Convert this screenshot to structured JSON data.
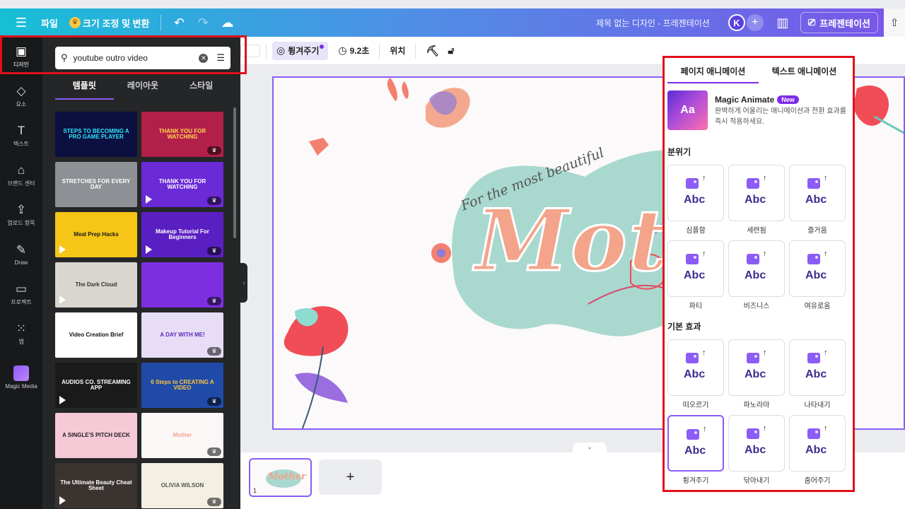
{
  "topbar": {
    "menu_icon": "hamburger-icon",
    "file_label": "파일",
    "resize_label": "크기 조정 및 변환",
    "title": "제목 없는 디자인 - 프레젠테이션",
    "avatar_initial": "K",
    "present_label": "프레젠테이션",
    "gradient_start": "#16bfd6",
    "gradient_end": "#7a55e8"
  },
  "rail": {
    "items": [
      {
        "label": "디자인",
        "icon": "layout-icon"
      },
      {
        "label": "요소",
        "icon": "shapes-icon"
      },
      {
        "label": "텍스트",
        "icon": "text-icon"
      },
      {
        "label": "브랜드 센터",
        "icon": "brand-icon"
      },
      {
        "label": "업로드 항목",
        "icon": "upload-icon"
      },
      {
        "label": "Draw",
        "icon": "draw-icon"
      },
      {
        "label": "프로젝트",
        "icon": "folder-icon"
      },
      {
        "label": "앱",
        "icon": "apps-icon"
      },
      {
        "label": "Magic Media",
        "icon": "magic-media-icon"
      }
    ]
  },
  "panel": {
    "search_value": "youtube outro video",
    "tabs": [
      "템플릿",
      "레이아웃",
      "스타일"
    ],
    "active_tab": "템플릿",
    "templates": [
      {
        "text": "STEPS TO BECOMING A PRO GAME PLAYER",
        "bg": "#0c1040",
        "fg": "#2ee6ff",
        "play": false,
        "premium": false
      },
      {
        "text": "THANK YOU FOR WATCHING",
        "bg": "#b21f4a",
        "fg": "#ffd84d",
        "play": false,
        "premium": true
      },
      {
        "text": "STRETCHES FOR EVERY DAY",
        "bg": "#8d9095",
        "fg": "#ffffff",
        "play": false,
        "premium": false
      },
      {
        "text": "THANK YOU FOR WATCHING",
        "bg": "#6a2ad6",
        "fg": "#ffffff",
        "play": true,
        "premium": true
      },
      {
        "text": "Meal Prep Hacks",
        "bg": "#f5c518",
        "fg": "#1a1a1a",
        "play": true,
        "premium": false
      },
      {
        "text": "Makeup Tutorial For Beginners",
        "bg": "#5a1fc2",
        "fg": "#ffffff",
        "play": true,
        "premium": true
      },
      {
        "text": "The Dark Cloud",
        "bg": "#d9d5cf",
        "fg": "#333333",
        "play": true,
        "premium": false
      },
      {
        "text": "",
        "bg": "#7d2fe0",
        "fg": "#ffffff",
        "play": false,
        "premium": true
      },
      {
        "text": "Video Creation Brief",
        "bg": "#ffffff",
        "fg": "#111111",
        "play": false,
        "premium": false
      },
      {
        "text": "A DAY WITH ME!",
        "bg": "#e7ddf7",
        "fg": "#5a2ab8",
        "play": false,
        "premium": true
      },
      {
        "text": "AUDIOS CO. STREAMING APP",
        "bg": "#1a1a1a",
        "fg": "#ffffff",
        "play": true,
        "premium": false
      },
      {
        "text": "6 Steps to CREATING A VIDEO",
        "bg": "#1f4aa8",
        "fg": "#ffc53d",
        "play": false,
        "premium": true
      },
      {
        "text": "A SINGLE'S PITCH DECK",
        "bg": "#f6c9d6",
        "fg": "#222222",
        "play": false,
        "premium": false
      },
      {
        "text": "Mother",
        "bg": "#fbf7f7",
        "fg": "#f3a48a",
        "play": false,
        "premium": true
      },
      {
        "text": "The Ultimate Beauty Cheat Sheet",
        "bg": "#3a3330",
        "fg": "#ffffff",
        "play": true,
        "premium": false
      },
      {
        "text": "OLIVIA WILSON",
        "bg": "#f3efe2",
        "fg": "#555555",
        "play": false,
        "premium": true
      }
    ]
  },
  "toolbar": {
    "animate_label": "튕겨주기",
    "duration_label": "9.2초",
    "position_label": "위치"
  },
  "canvas": {
    "tagline": "For the most beautiful",
    "word": "Mother",
    "border_color": "#8b5cf6"
  },
  "pages": {
    "page_number": "1",
    "add_label": "+"
  },
  "animation_panel": {
    "tabs": [
      "페이지 애니메이션",
      "텍스트 애니메이션"
    ],
    "magic_title": "Magic Animate",
    "magic_badge": "New",
    "magic_desc": "완벽하게 어울리는 애니메이션과 전환 효과를 즉시 적용하세요.",
    "magic_icon_text": "Aa",
    "section_mood": "분위기",
    "mood_items": [
      "심플함",
      "세련됨",
      "즐거움",
      "파티",
      "비즈니스",
      "여유로움"
    ],
    "section_basic": "기본 효과",
    "basic_items": [
      "떠오르기",
      "파노라마",
      "나타내기",
      "튕겨주기",
      "닦아내기",
      "줌어주기"
    ],
    "selected": "튕겨주기",
    "abc_text": "Abc"
  }
}
